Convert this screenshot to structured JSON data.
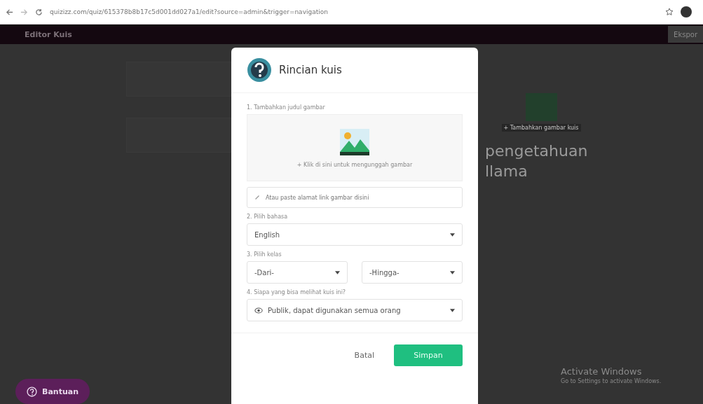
{
  "browser": {
    "url": "quizizz.com/quiz/615378b8b17c5d001dd027a1/edit?source=admin&trigger=navigation"
  },
  "header": {
    "title": "Editor Kuis",
    "action": "Ekspor"
  },
  "background": {
    "cover_caption": "+ Tambahkan gambar kuis",
    "quiz_title": [
      "pengetahuan",
      "llama"
    ],
    "help": "Bantuan"
  },
  "modal": {
    "title": "Rincian kuis",
    "image_label": "1. Tambahkan judul gambar",
    "upload_text": "+ Klik di sini untuk mengunggah gambar",
    "link_placeholder": "Atau paste alamat link gambar disini",
    "language_label": "2. Pilih bahasa",
    "language": "English",
    "grade_label": "3. Pilih kelas",
    "grade_from": "-Dari-",
    "grade_to": "-Hingga-",
    "visibility_label": "4. Siapa yang bisa melihat kuis ini?",
    "visibility": "Publik, dapat digunakan semua orang",
    "buttons": [
      {
        "kind": "plain",
        "label": "Batal"
      },
      {
        "kind": "primary",
        "label": "Simpan"
      }
    ]
  },
  "os_notice": {
    "title": "Activate Windows",
    "text": "Go to Settings to activate Windows."
  }
}
